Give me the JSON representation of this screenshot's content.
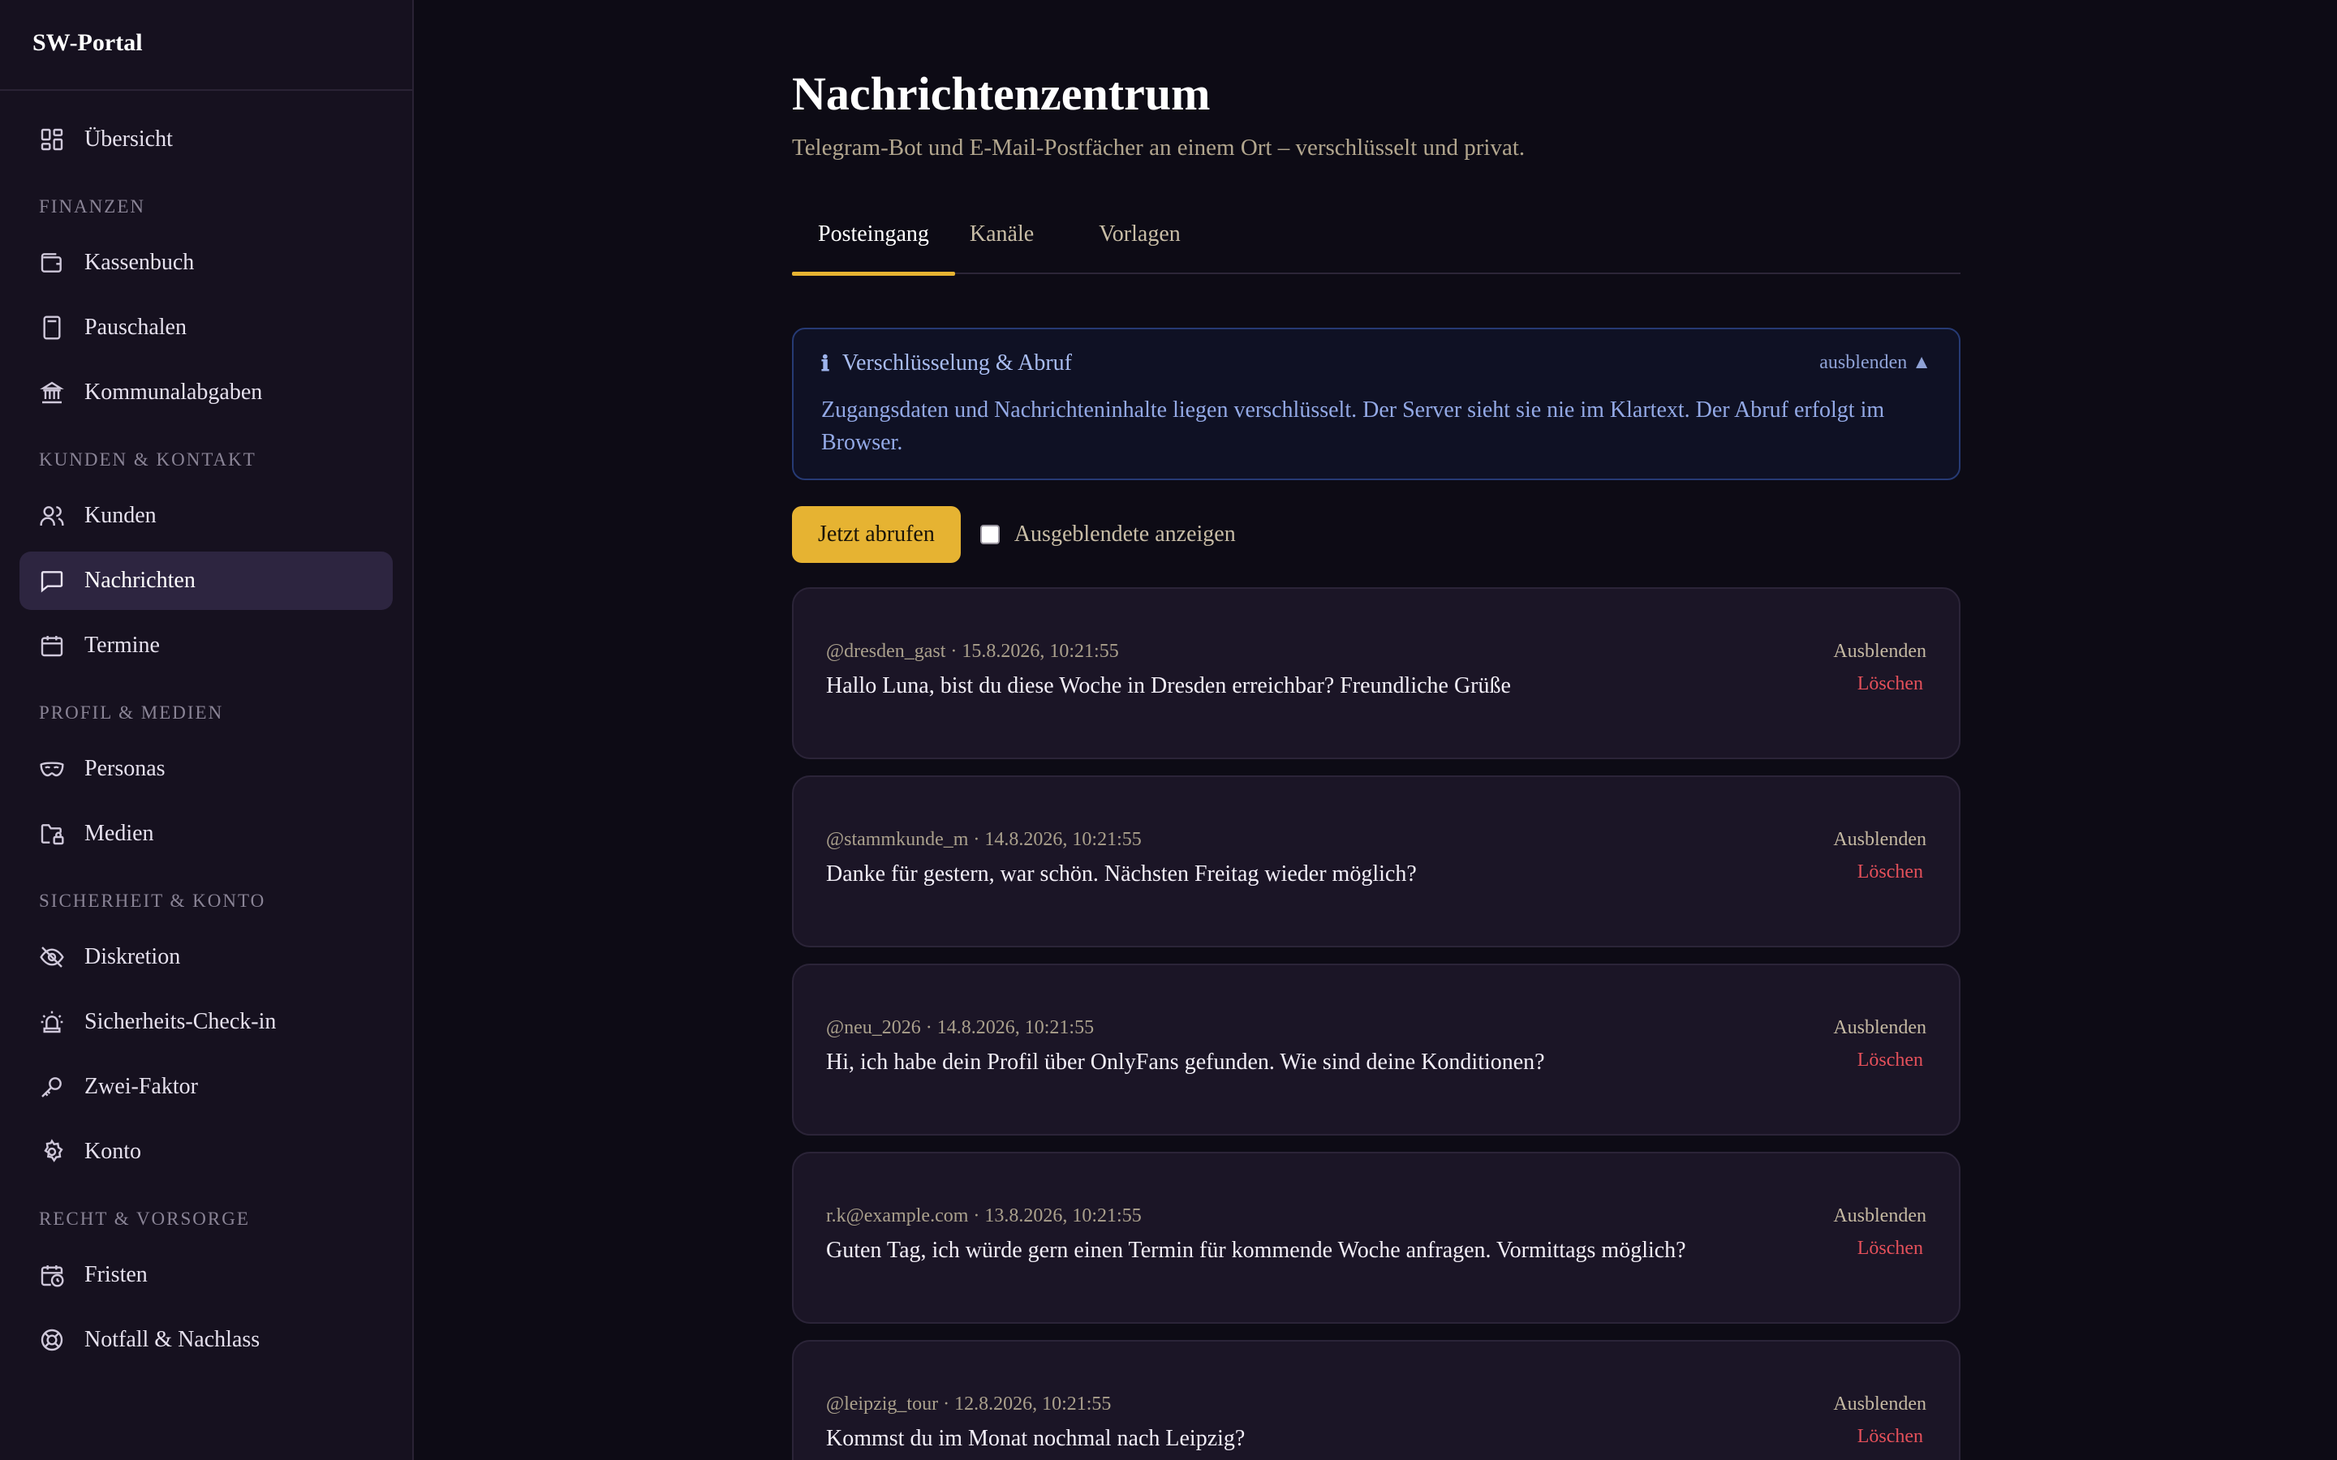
{
  "app": {
    "brand": "SW-Portal"
  },
  "sidebar": {
    "overview": "Übersicht",
    "sections": {
      "finanzen": "FINANZEN",
      "kunden": "KUNDEN & KONTAKT",
      "profil": "PROFIL & MEDIEN",
      "sicherheit": "SICHERHEIT & KONTO",
      "recht": "RECHT & VORSORGE"
    },
    "items": {
      "kassenbuch": "Kassenbuch",
      "pauschalen": "Pauschalen",
      "kommunalabgaben": "Kommunalabgaben",
      "kunden": "Kunden",
      "nachrichten": "Nachrichten",
      "termine": "Termine",
      "personas": "Personas",
      "medien": "Medien",
      "diskretion": "Diskretion",
      "sicherheits_check_in": "Sicherheits-Check-in",
      "zwei_faktor": "Zwei-Faktor",
      "konto": "Konto",
      "fristen": "Fristen",
      "notfall": "Notfall & Nachlass"
    },
    "active": "nachrichten"
  },
  "page": {
    "title": "Nachrichtenzentrum",
    "subtitle": "Telegram-Bot und E-Mail-Postfächer an einem Ort – verschlüsselt und privat."
  },
  "tabs": [
    "Posteingang",
    "Kanäle",
    "Vorlagen"
  ],
  "info": {
    "icon": "ℹ",
    "title": "Verschlüsselung & Abruf",
    "toggle": "ausblenden ▲",
    "text": "Zugangsdaten und Nachrichteninhalte liegen verschlüsselt. Der Server sieht sie nie im Klartext. Der Abruf erfolgt im Browser."
  },
  "actions": {
    "fetch_label": "Jetzt abrufen",
    "show_hidden_label": "Ausgeblendete anzeigen",
    "show_hidden_checked": false
  },
  "messages": [
    {
      "meta": "@dresden_gast · 15.8.2026, 10:21:55",
      "text": "Hallo Luna, bist du diese Woche in Dresden erreichbar? Freundliche Grüße",
      "hide": "Ausblenden",
      "delete": "Löschen"
    },
    {
      "meta": "@stammkunde_m · 14.8.2026, 10:21:55",
      "text": "Danke für gestern, war schön. Nächsten Freitag wieder möglich?",
      "hide": "Ausblenden",
      "delete": "Löschen"
    },
    {
      "meta": "@neu_2026 · 14.8.2026, 10:21:55",
      "text": "Hi, ich habe dein Profil über OnlyFans gefunden. Wie sind deine Konditionen?",
      "hide": "Ausblenden",
      "delete": "Löschen"
    },
    {
      "meta": "r.k@example.com · 13.8.2026, 10:21:55",
      "text": "Guten Tag, ich würde gern einen Termin für kommende Woche anfragen. Vormittags möglich?",
      "hide": "Ausblenden",
      "delete": "Löschen"
    },
    {
      "meta": "@leipzig_tour · 12.8.2026, 10:21:55",
      "text": "Kommst du im Monat nochmal nach Leipzig?",
      "hide": "Ausblenden",
      "delete": "Löschen"
    }
  ]
}
